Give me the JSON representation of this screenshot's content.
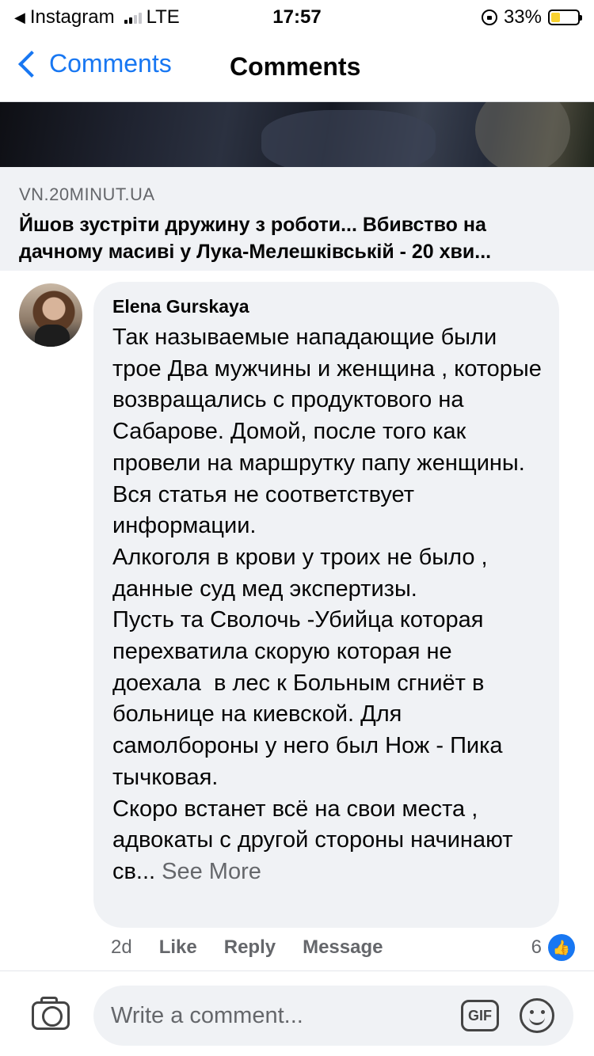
{
  "status_bar": {
    "back_app": "Instagram",
    "network": "LTE",
    "time": "17:57",
    "battery_percent": "33%",
    "battery_level": 0.33
  },
  "nav": {
    "back_label": "Comments",
    "title": "Comments"
  },
  "link_preview": {
    "domain": "VN.20MINUT.UA",
    "title": "Йшов зустріти дружину з роботи... Вбивство на дачному масиві у Лука-Мелешківській - 20 хви..."
  },
  "comment": {
    "author": "Elena Gurskaya",
    "text": "Так называемые нападающие были трое Два мужчины и женщина , которые возвращались с продуктового на Сабарове. Домой, после того как провели на маршрутку папу женщины. Вся статья не соответствует информации.\nАлкоголя в крови у троих не было , данные суд мед экспертизы.\nПусть та Сволочь -Убийца которая перехватила скорую которая не доехала  в лес к Больным сгниёт в больнице на киевской. Для самолбороны у него был Нож - Пика тычковая.\nСкоро встанет всё на свои места , адвокаты с другой стороны начинают св...",
    "see_more": "See More",
    "time_ago": "2d",
    "actions": {
      "like": "Like",
      "reply": "Reply",
      "message": "Message"
    },
    "reaction_count": "6"
  },
  "composer": {
    "placeholder": "Write a comment...",
    "gif_label": "GIF"
  },
  "colors": {
    "accent": "#1877f2",
    "bubble": "#f0f2f5",
    "secondary_text": "#65676b",
    "battery": "#f8d130"
  },
  "icons": {
    "camera": "camera-icon",
    "gif": "gif-icon",
    "emoji": "emoji-icon",
    "like": "like-icon"
  }
}
